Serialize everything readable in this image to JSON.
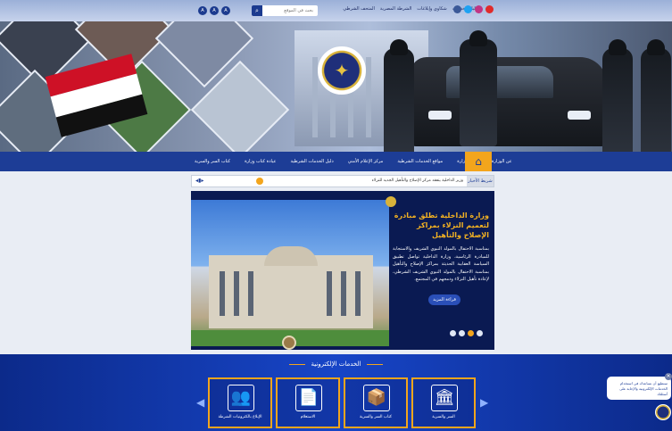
{
  "topbar": {
    "links": [
      "دليل الخدمات",
      "شكاوي وإبلاغات",
      "الشرطة المصرية",
      "المتحف الشرطي"
    ],
    "search_placeholder": "بحث في الموقع",
    "a11y": [
      "A",
      "A",
      "A"
    ],
    "social": [
      {
        "name": "facebook-icon",
        "color": "#3b5998"
      },
      {
        "name": "twitter-icon",
        "color": "#1da1f2"
      },
      {
        "name": "instagram-icon",
        "color": "#c13584"
      },
      {
        "name": "youtube-icon",
        "color": "#e02b2b"
      }
    ]
  },
  "nav": {
    "home_icon": "home-icon",
    "items": [
      "عن الوزارة",
      "عن الوزارة",
      "مواقع الخدمات الشرطية",
      "مركز الإعلام الأمني",
      "دليل الخدمات الشرطية",
      "عيادة كتاب وزارة",
      "كتاب السر والسرية"
    ]
  },
  "ticker": {
    "label": "شريط الأخبار",
    "text": "وزير الداخلية يتفقد مركز الإصلاح والتأهيل الجديد للنزلاء",
    "control": "◂▮▸"
  },
  "slide": {
    "title": "وزارة الداخلية تطلق مبادرة لتعميم النزلاء بمراكز الإصلاح والتأهيل",
    "body": "بمناسبة الاحتفال بالمولد النبوي الشريف والاستجابة للمبادرة الرئاسية، وزارة الداخلية تواصل تطبيق السياسة العقابية الحديثة بمراكز الإصلاح والتأهيل بمناسبة الاحتفال بالمولد النبوي الشريف الشرطي، لإعادة تأهيل النزلاء ودمجهم في المجتمع.",
    "button": "قراءة المزيد",
    "dots": 4,
    "active_dot": 2
  },
  "services": {
    "title": "الخدمات الإلكترونية",
    "cards": [
      {
        "label": "الإبلاغ بالكترونيات الشرطة",
        "icon": "people-icon",
        "glyph": "👥"
      },
      {
        "label": "الاستعلام",
        "icon": "document-icon",
        "glyph": "📄"
      },
      {
        "label": "كتاب السر والسرية",
        "icon": "box-icon",
        "glyph": "📦"
      },
      {
        "label": "السر والسرية",
        "icon": "building-icon",
        "glyph": "🏛"
      }
    ]
  },
  "chat": {
    "message": "ستطيع أن نساعدك في استخدام الخدمات الإلكترونية والإجابة على أسئلتك",
    "close": "×"
  }
}
